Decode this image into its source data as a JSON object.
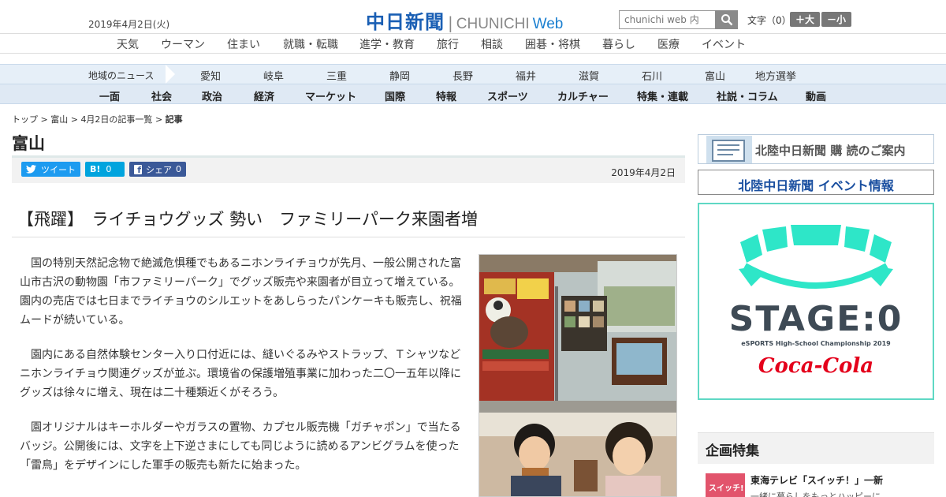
{
  "header": {
    "date": "2019年4月2日(火)",
    "logo_jp": "中日新聞",
    "logo_sep": "|",
    "logo_en": "CHUNICHI",
    "logo_web": "Web",
    "search_placeholder": "chunichi web 内",
    "font_size_label": "文字（0）",
    "font_larger": "＋大",
    "font_smaller": "－小"
  },
  "nav_topics": [
    "天気",
    "ウーマン",
    "住まい",
    "就職・転職",
    "進学・教育",
    "旅行",
    "相談",
    "囲碁・将棋",
    "暮らし",
    "医療",
    "イベント"
  ],
  "nav_regions": {
    "label": "地域のニュース",
    "items": [
      "愛知",
      "岐阜",
      "三重",
      "静岡",
      "長野",
      "福井",
      "滋賀",
      "石川",
      "富山",
      "地方選挙"
    ]
  },
  "nav_sections": [
    "一面",
    "社会",
    "政治",
    "経済",
    "マーケット",
    "国際",
    "特報",
    "スポーツ",
    "カルチャー",
    "特集・連載",
    "社説・コラム",
    "動画"
  ],
  "breadcrumb": {
    "top": "トップ",
    "sep": ">",
    "region": "富山",
    "list": "4月2日の記事一覧",
    "current": "記事"
  },
  "page_title": "富山",
  "share": {
    "tweet": "ツイート",
    "hatena_mark": "B!",
    "hatena_count": "0",
    "fb_share": "シェア",
    "fb_count": "0",
    "date": "2019年4月2日"
  },
  "article": {
    "headline": "【飛躍】　ライチョウグッズ 勢い　ファミリーパーク来園者増",
    "paragraphs": [
      "国の特別天然記念物で絶滅危惧種でもあるニホンライチョウが先月、一般公開された富山市古沢の動物園「市ファミリーパーク」でグッズ販売や来園者が目立って増えている。園内の売店では七日までライチョウのシルエットをあしらったパンケーキも販売し、祝福ムードが続いている。",
      "園内にある自然体験センター入り口付近には、縫いぐるみやストラップ、Ｔシャツなどニホンライチョウ関連グッズが並ぶ。環境省の保護増殖事業に加わった二〇一五年以降にグッズは徐々に増え、現在は二十種類近くがそろう。",
      "園オリジナルはキーホルダーやガラスの置物、カプセル販売機「ガチャポン」で当たるバッジ。公開後には、文字を上下逆さまにしても同じように読めるアンビグラムを使った「雷鳥」をデザインにした軍手の販売も新たに始まった。"
    ]
  },
  "sidebar": {
    "banner1": "北陸中日新聞 購 読のご案内",
    "banner2": "北陸中日新聞 イベント情報",
    "stage_title": "STAGE:0",
    "stage_sub": "eSPORTS High-School Championship 2019",
    "stage_brand": "Coca-Cola",
    "kikaku_header": "企画特集",
    "kikaku_thumb": "スイッチ!",
    "kikaku_title": "東海テレビ「スイッチ！」一新",
    "kikaku_desc": "一緒に暮らしをもっとハッピーに"
  },
  "colors": {
    "logo_blue": "#1a5fb4",
    "nav_bg": "#dfe9f4",
    "twitter": "#1d9bf0",
    "hatena": "#00a4de",
    "facebook": "#3b5998",
    "stage_teal": "#2ee6c8",
    "coke_red": "#e4001b"
  }
}
